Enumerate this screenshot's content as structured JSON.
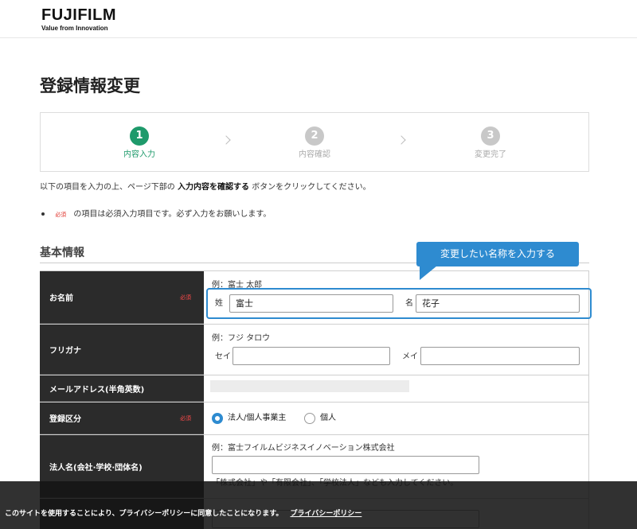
{
  "header": {
    "logo_text": "FUJIFILM",
    "logo_tagline": "Value from Innovation"
  },
  "page": {
    "title": "登録情報変更",
    "instruction_pre": "以下の項目を入力の上、ページ下部の",
    "instruction_bold": "入力内容を確認する",
    "instruction_post": "ボタンをクリックしてください。",
    "note_required_badge": "必須",
    "note_text": "の項目は必須入力項目です。必ず入力をお願いします。",
    "section_title": "基本情報"
  },
  "steps": [
    {
      "number": "1",
      "label": "内容入力",
      "state": "active"
    },
    {
      "number": "2",
      "label": "内容確認",
      "state": "inactive"
    },
    {
      "number": "3",
      "label": "変更完了",
      "state": "inactive"
    }
  ],
  "tooltip": {
    "text": "変更したい名称を入力する"
  },
  "form": {
    "required_label": "必須",
    "name": {
      "label": "お名前",
      "example": "例：富士 太郎",
      "last_prefix": "姓",
      "last_value": "富士",
      "first_prefix": "名",
      "first_value": "花子"
    },
    "furigana": {
      "label": "フリガナ",
      "example": "例：フジ タロウ",
      "last_prefix": "セイ",
      "last_value": "",
      "first_prefix": "メイ",
      "first_value": ""
    },
    "email": {
      "label": "メールアドレス(半角英数)"
    },
    "registration_type": {
      "label": "登録区分",
      "option_corporate": "法人/個人事業主",
      "option_individual": "個人",
      "selected": "法人/個人事業主"
    },
    "company": {
      "label": "法人名(会社·学校·団体名)",
      "example": "例：富士フイルムビジネスイノベーション株式会社",
      "value": "",
      "hint": "「株式会社」や「有限会社」、「学校法人」なども入力してください。"
    }
  },
  "cookie": {
    "text": "このサイトを使用することにより、プライバシーポリシーに同意したことになります。",
    "link": "プライバシーポリシー"
  },
  "colors": {
    "accent_green": "#1e9a6b",
    "accent_blue": "#2e8bd0",
    "required_red": "#e0322a",
    "label_bg": "#2b2b2b"
  }
}
